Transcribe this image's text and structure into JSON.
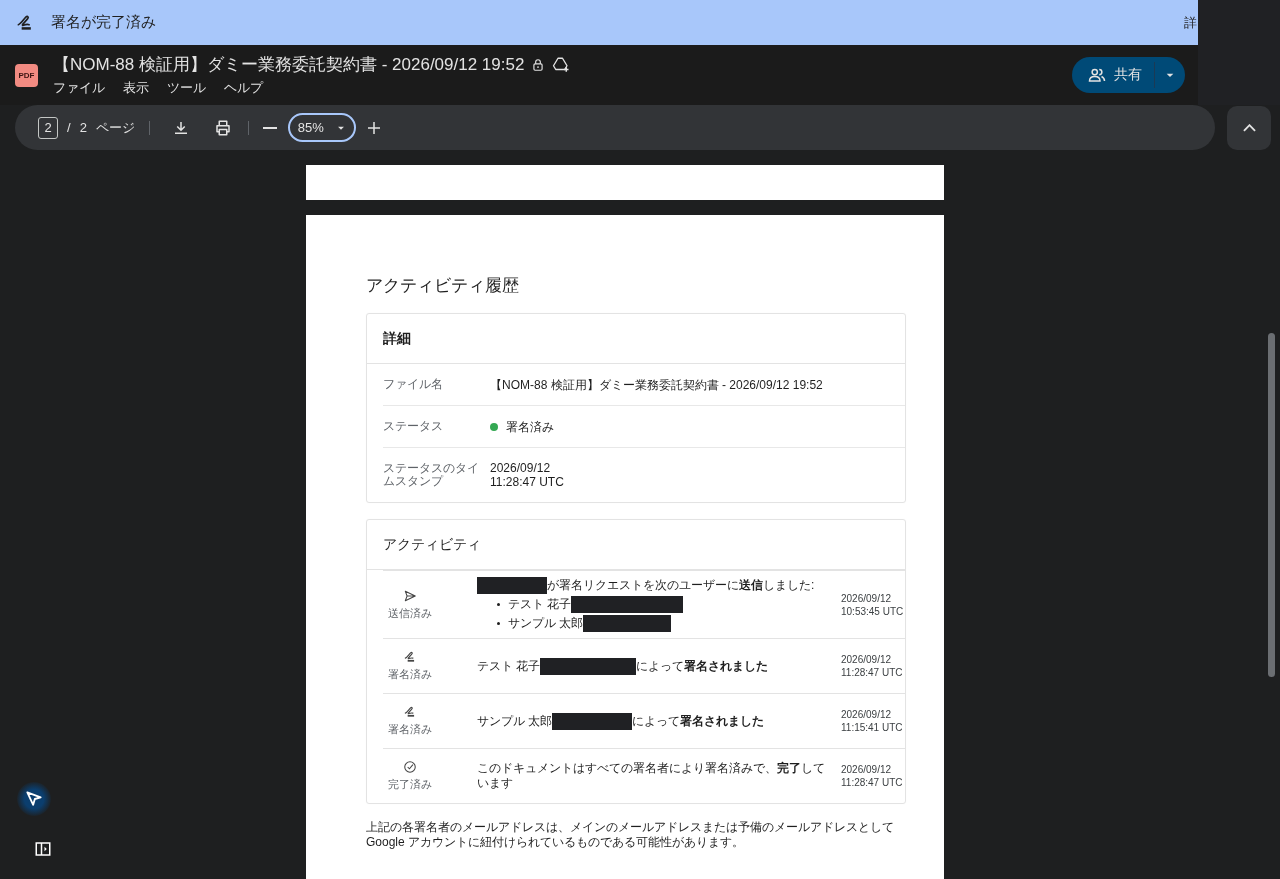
{
  "banner": {
    "title": "署名が完了済み",
    "side_text": "詳"
  },
  "document": {
    "badge": "PDF",
    "title": "【NOM-88 検証用】ダミー業務委託契約書 - 2026/09/12 19:52",
    "locked": true,
    "menus": [
      "ファイル",
      "表示",
      "ツール",
      "ヘルプ"
    ],
    "share_label": "共有"
  },
  "toolbar": {
    "page_current": "2",
    "page_separator": "/",
    "page_total": "2",
    "page_unit": "ページ",
    "zoom": "85%",
    "zoom_focused": true
  },
  "report": {
    "heading": "アクティビティ履歴",
    "details": {
      "title": "詳細",
      "rows": [
        {
          "label": "ファイル名",
          "lines": [
            "【NOM-88 検証用】ダミー業務委託契約書 - 2026/09/12 19:52"
          ]
        },
        {
          "label": "ステータス",
          "lines": [
            "署名済み"
          ],
          "color": "#34a853"
        },
        {
          "label": "ステータスのタイムスタンプ",
          "lines": [
            "2026/09/12",
            "11:28:47 UTC"
          ]
        }
      ]
    },
    "activity": {
      "title": "アクティビティ",
      "rows": [
        {
          "kind": "sent",
          "status": "送信済み",
          "message": [
            {
              "kind": "redacted"
            },
            {
              "kind": "text",
              "text": "が署名リクエストを次のユーザーに**送信**しました:"
            }
          ],
          "bullets": [
            [
              {
                "kind": "text",
                "text": "テスト 花子"
              },
              {
                "kind": "redacted"
              }
            ],
            [
              {
                "kind": "text",
                "text": "サンプル 太郎"
              },
              {
                "kind": "redacted"
              }
            ]
          ],
          "time_lines": [
            "2026/09/12",
            "10:53:45 UTC"
          ]
        },
        {
          "kind": "signed",
          "status": "署名済み",
          "message": [
            {
              "kind": "text",
              "text": "テスト 花子"
            },
            {
              "kind": "redacted"
            },
            {
              "kind": "text",
              "text": "によって**署名されました**"
            }
          ],
          "time_lines": [
            "2026/09/12",
            "11:28:47 UTC"
          ]
        },
        {
          "kind": "signed",
          "status": "署名済み",
          "message": [
            {
              "kind": "text",
              "text": "サンプル 太郎"
            },
            {
              "kind": "redacted"
            },
            {
              "kind": "text",
              "text": "によって**署名されました**"
            }
          ],
          "time_lines": [
            "2026/09/12",
            "11:15:41 UTC"
          ]
        },
        {
          "kind": "completed",
          "status": "完了済み",
          "message": [
            {
              "kind": "text",
              "text": "このドキュメントはすべての署名者により署名済みで、**完了**しています"
            }
          ],
          "time_lines": [
            "2026/09/12",
            "11:28:47 UTC"
          ]
        }
      ]
    },
    "footnote": "上記の各署名者のメールアドレスは、メインのメールアドレスまたは予備のメールアドレスとして Google アカウントに紐付けられているものである可能性があります。"
  }
}
